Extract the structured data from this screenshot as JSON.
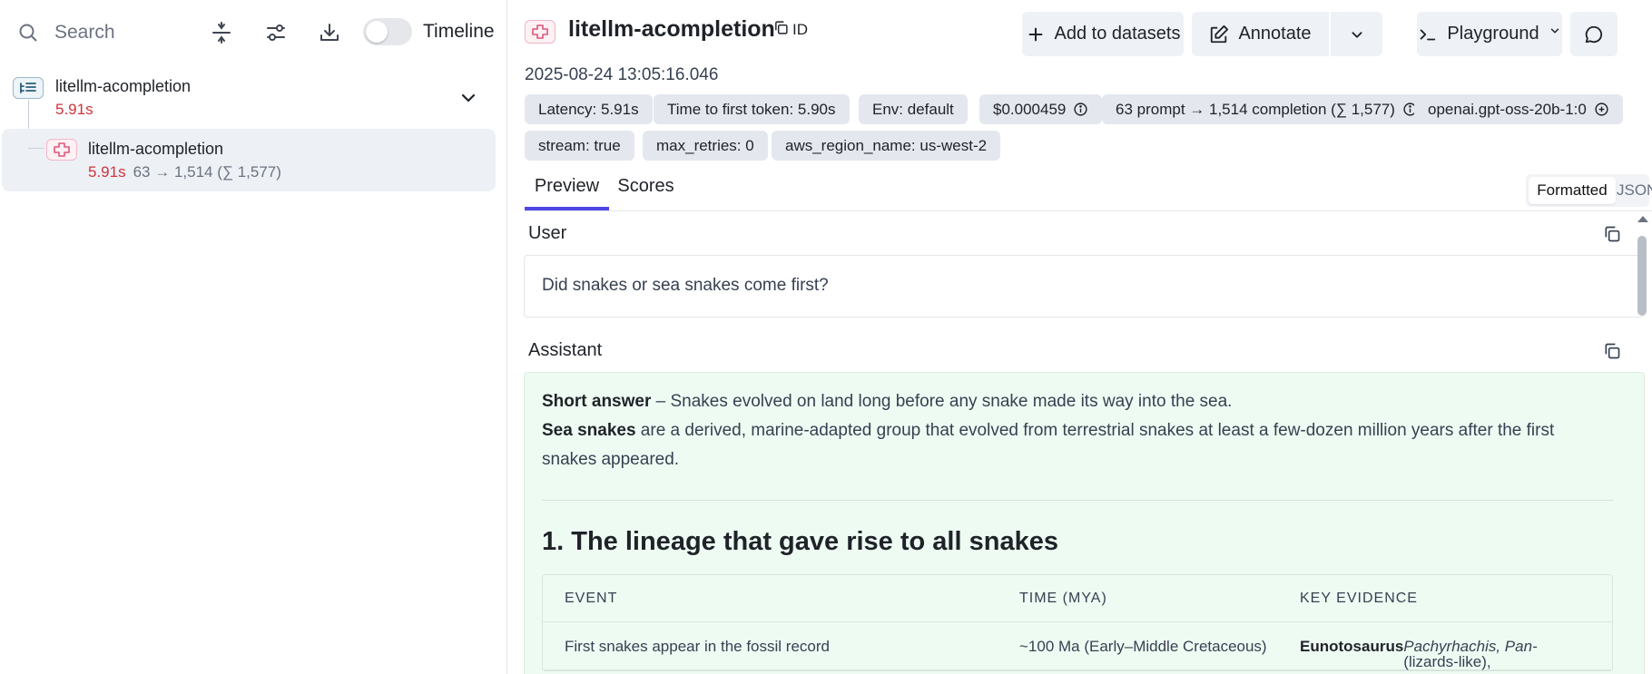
{
  "left": {
    "search": {
      "placeholder": "Search"
    },
    "toolbar": {
      "timeline_label": "Timeline"
    },
    "tree": {
      "root": {
        "name": "litellm-acompletion",
        "duration": "5.91s"
      },
      "child": {
        "name": "litellm-acompletion",
        "duration": "5.91s",
        "tokens": "63 → 1,514 (∑ 1,577)"
      }
    }
  },
  "header": {
    "title": "litellm-acompletion",
    "id_label": "ID",
    "timestamp": "2025-08-24 13:05:16.046",
    "buttons": {
      "add_to_datasets": "Add to datasets",
      "annotate": "Annotate",
      "playground": "Playground"
    }
  },
  "pills": {
    "latency": "Latency: 5.91s",
    "ttft": "Time to first token: 5.90s",
    "env": "Env: default",
    "cost": "$0.000459",
    "tokens": "63 prompt → 1,514 completion (∑ 1,577)",
    "model": "openai.gpt-oss-20b-1:0",
    "stream": "stream: true",
    "max_retries": "max_retries: 0",
    "region": "aws_region_name: us-west-2"
  },
  "tabs": {
    "preview": "Preview",
    "scores": "Scores"
  },
  "view_toggle": {
    "formatted": "Formatted",
    "json": "JSON"
  },
  "messages": {
    "user": {
      "role": "User",
      "content": "Did snakes or sea snakes come first?"
    },
    "assistant": {
      "role": "Assistant",
      "short_answer_label": "Short answer",
      "short_answer_text": " – Snakes evolved on land long before any snake made its way into the sea.",
      "sea_snakes_label": "Sea snakes",
      "sea_snakes_text": " are a derived, marine-adapted group that evolved from terrestrial snakes at least a few-dozen million years after the first snakes appeared.",
      "heading": "1. The lineage that gave rise to all snakes",
      "table": {
        "headers": [
          "EVENT",
          "TIME (MYA)",
          "KEY EVIDENCE"
        ],
        "rows": [
          {
            "event": "First snakes appear in the fossil record",
            "time": "~100 Ma (Early–Middle Cretaceous)",
            "evidence_bold": "Eunotosaurus",
            "evidence_plain": " (lizards-like), ",
            "evidence_italic": "Pachyrhachis, Pan-"
          }
        ]
      }
    }
  }
}
